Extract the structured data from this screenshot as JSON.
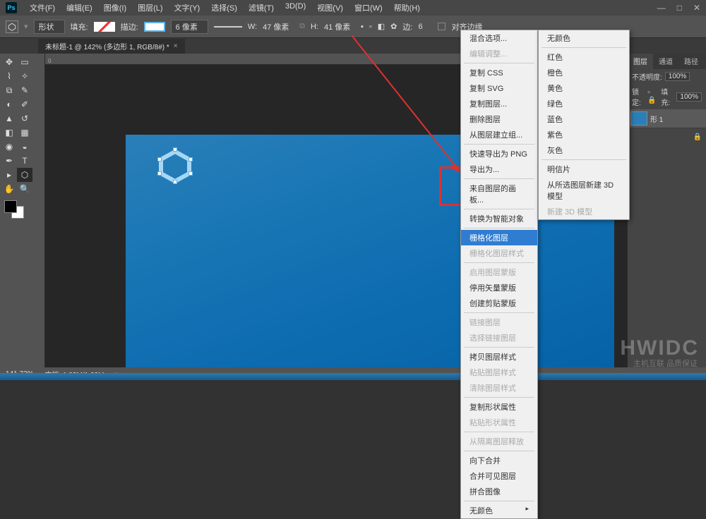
{
  "app": {
    "logo_text": "Ps"
  },
  "menubar": {
    "file": "文件(F)",
    "edit": "编辑(E)",
    "image": "图像(I)",
    "layer": "图层(L)",
    "type": "文字(Y)",
    "select": "选择(S)",
    "filter": "滤镜(T)",
    "threeD": "3D(D)",
    "view": "视图(V)",
    "window": "窗口(W)",
    "help": "帮助(H)"
  },
  "window_controls": {
    "min": "—",
    "max": "□",
    "close": "✕"
  },
  "options": {
    "shape_mode": "形状",
    "fill_label": "填充:",
    "stroke_label": "描边:",
    "stroke_width": "6 像素",
    "w_label": "W:",
    "w_value": "47 像素",
    "h_label": "H:",
    "h_value": "41 像素",
    "sides_label": "边:",
    "sides_value": "6",
    "align_edges": "对齐边缘"
  },
  "doc_tab": {
    "title": "未标题-1 @ 142% (多边形 1, RGB/8#) *",
    "close": "×"
  },
  "panels": {
    "layers_tab": "图层",
    "channels_tab": "通道",
    "paths_tab": "路径",
    "opacity_label": "不透明度:",
    "opacity_value": "100%",
    "lock_label": "锁定:",
    "fill_label": "填充:",
    "fill_value": "100%",
    "layer1_name": "形 1"
  },
  "context_menu": {
    "blend_options": "混合选项...",
    "edit_adjustment": "编辑调整...",
    "copy_css": "复制 CSS",
    "copy_svg": "复制 SVG",
    "duplicate_layer": "复制图层...",
    "delete_layer": "删除图层",
    "group_from_layers": "从图层建立组...",
    "quick_export_png": "快速导出为 PNG",
    "export_as": "导出为...",
    "artboard_from_layers": "来自图层的画板...",
    "convert_smart_object": "转换为智能对象",
    "rasterize_layer": "栅格化图层",
    "rasterize_layer_style": "栅格化图层样式",
    "enable_layer_mask": "启用图层蒙版",
    "disable_vector_mask": "停用矢量蒙版",
    "create_clipping_mask": "创建剪贴蒙版",
    "link_layers": "链接图层",
    "select_linked": "选择链接图层",
    "copy_layer_style": "拷贝图层样式",
    "paste_layer_style": "粘贴图层样式",
    "clear_layer_style": "清除图层样式",
    "copy_shape_attrs": "复制形状属性",
    "paste_shape_attrs": "粘贴形状属性",
    "release_isolation": "从隔离图层释放",
    "merge_down": "向下合并",
    "merge_visible": "合并可见图层",
    "flatten_image": "拼合图像"
  },
  "submenu": {
    "no_color": "无颜色",
    "red": "红色",
    "orange": "橙色",
    "yellow": "黄色",
    "green": "绿色",
    "blue": "蓝色",
    "purple": "紫色",
    "gray": "灰色",
    "postcard": "明信片",
    "new_3d_from_layer": "从所选图层新建 3D 模型",
    "new_3d_mesh": "新建 3D 模型"
  },
  "status": {
    "zoom": "141.72%",
    "doc_info": "文档: 1.83M/1.83M"
  },
  "watermark": {
    "main": "HWIDC",
    "sub": "主机互联  品质保证"
  },
  "ruler": {
    "zero": "0"
  }
}
